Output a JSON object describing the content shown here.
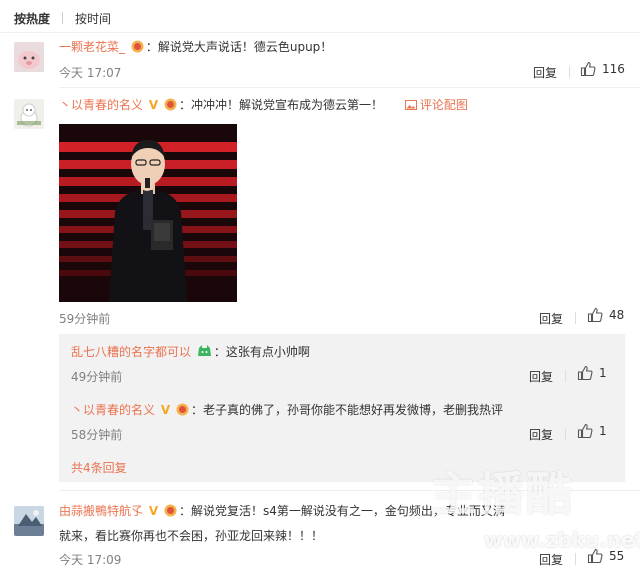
{
  "sort": {
    "hot": "按热度",
    "time": "按时间"
  },
  "comments": [
    {
      "user": "一颗老花菜_",
      "text": "：解说党大声说话！德云色upup！",
      "time": "今天 17:07",
      "reply": "回复",
      "likes": "116"
    },
    {
      "user": "丶以青春的名义",
      "text": "：冲冲冲！解说党宣布成为德云第一！",
      "image_link": "评论配图",
      "time": "59分钟前",
      "reply": "回复",
      "likes": "48",
      "sub_replies": [
        {
          "user": "乱七八糟的名字都可以",
          "text": "：这张有点小帅啊",
          "time": "49分钟前",
          "reply": "回复",
          "likes": "1"
        },
        {
          "user": "丶以青春的名义",
          "text": "：老子真的佛了，孙哥你能不能想好再发微博，老删我热评",
          "time": "58分钟前",
          "reply": "回复",
          "likes": "1"
        }
      ],
      "more": "共4条回复"
    },
    {
      "user": "由蒜搬鴨特航孓",
      "text_line1": "：解说党复活！s4第一解说没有之一，金句频出，专业而又满",
      "text_line2": "就来，看比赛你再也不会困，孙亚龙回来辣！！！",
      "time": "今天 17:09",
      "reply": "回复",
      "likes": "55"
    }
  ],
  "watermark": {
    "big": "主播酷",
    "url": "www.zbku.net"
  },
  "colors": {
    "username": "#eb7350",
    "badge_gold": "#f5a623",
    "subbox_bg": "#f2f2f2"
  },
  "icons": [
    "thumb-up-icon",
    "vip-v-icon",
    "fan-medal-icon",
    "picture-icon"
  ]
}
